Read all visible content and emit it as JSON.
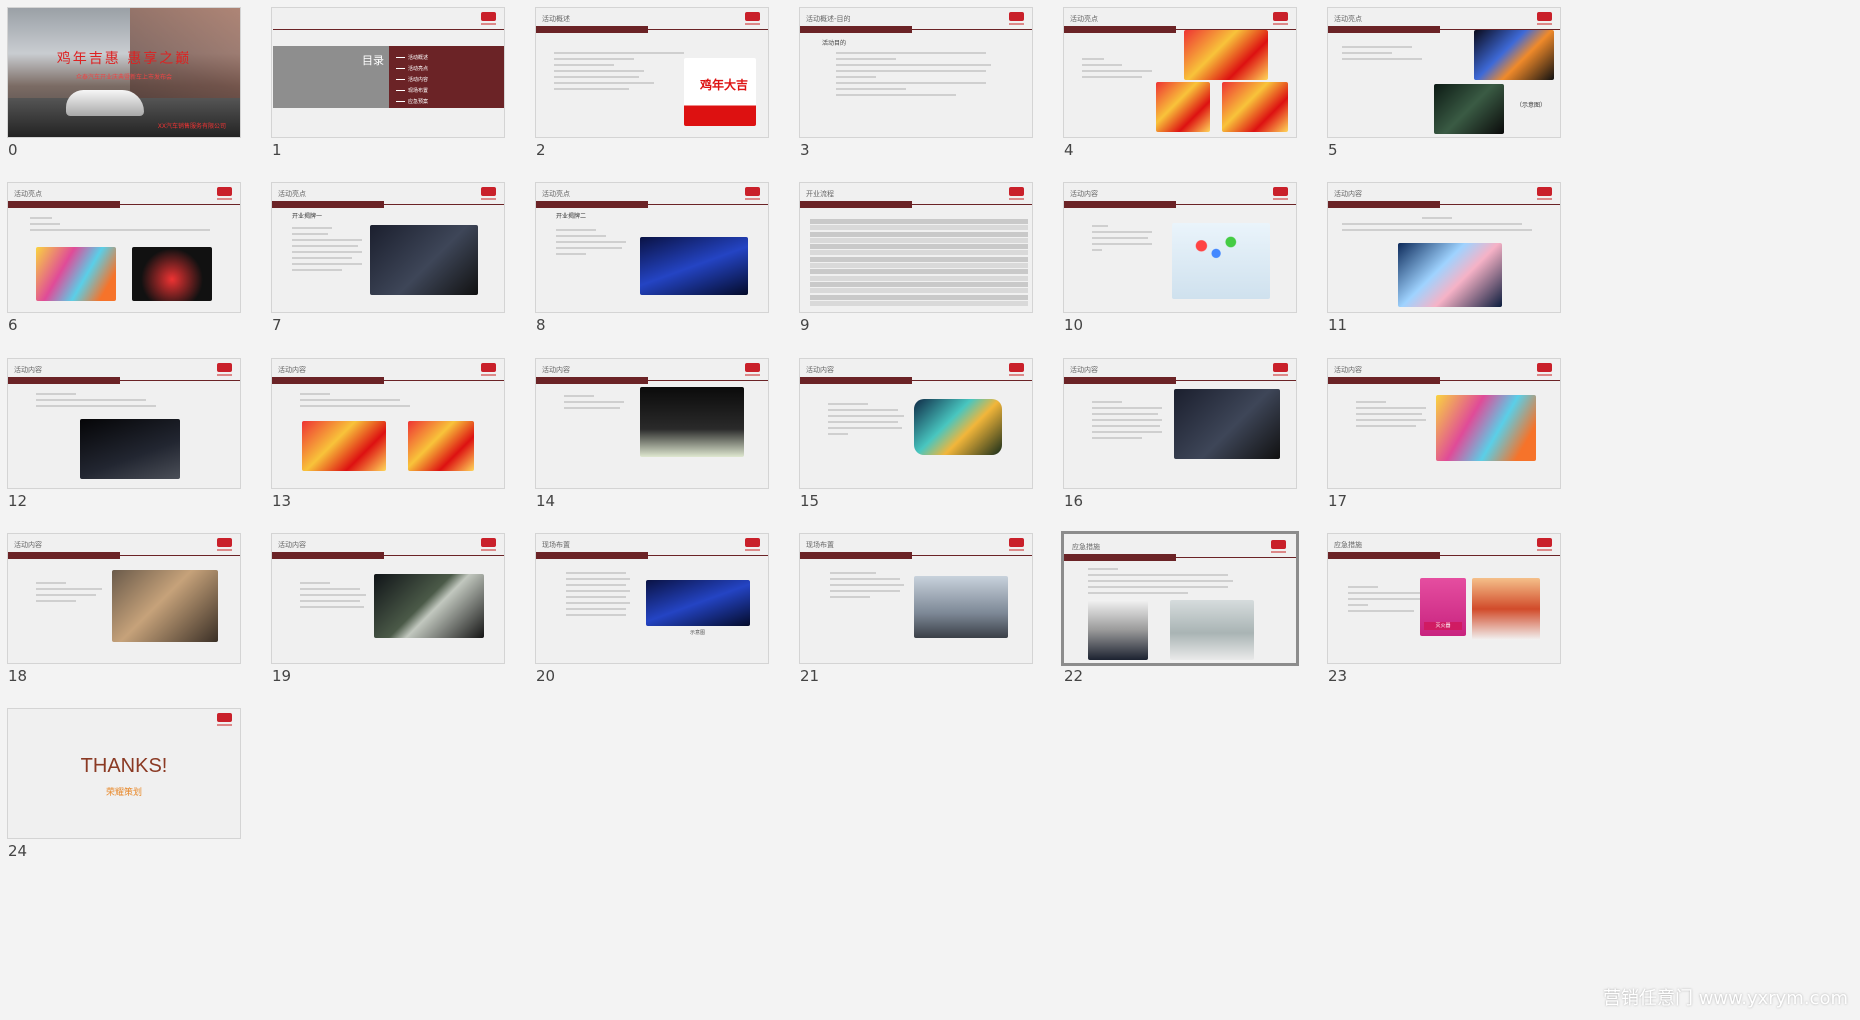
{
  "slides": [
    {
      "index": "0",
      "cover_title": "鸡年吉惠  惠享之巅",
      "cover_sub": "众泰汽车开业庆典暨新车上市发布会",
      "cover_org": "XX汽车销售服务有限公司"
    },
    {
      "index": "1",
      "toc_title": "目录",
      "toc_items": [
        "活动概述",
        "活动亮点",
        "活动内容",
        "现场布置",
        "应急预案"
      ]
    },
    {
      "index": "2",
      "header": "活动概述",
      "poster": "鸡年大吉"
    },
    {
      "index": "3",
      "header": "活动概述-目的",
      "section": "活动目的"
    },
    {
      "index": "4",
      "header": "活动亮点"
    },
    {
      "index": "5",
      "header": "活动亮点",
      "caption": "（示意图）"
    },
    {
      "index": "6",
      "header": "活动亮点"
    },
    {
      "index": "7",
      "header": "活动亮点",
      "section": "开业揭牌一"
    },
    {
      "index": "8",
      "header": "活动亮点",
      "section": "开业揭牌二"
    },
    {
      "index": "9",
      "header": "开业流程"
    },
    {
      "index": "10",
      "header": "活动内容"
    },
    {
      "index": "11",
      "header": "活动内容"
    },
    {
      "index": "12",
      "header": "活动内容"
    },
    {
      "index": "13",
      "header": "活动内容"
    },
    {
      "index": "14",
      "header": "活动内容"
    },
    {
      "index": "15",
      "header": "活动内容"
    },
    {
      "index": "16",
      "header": "活动内容"
    },
    {
      "index": "17",
      "header": "活动内容"
    },
    {
      "index": "18",
      "header": "活动内容"
    },
    {
      "index": "19",
      "header": "活动内容"
    },
    {
      "index": "20",
      "header": "现场布置",
      "caption": "示意图"
    },
    {
      "index": "21",
      "header": "现场布置"
    },
    {
      "index": "22",
      "header": "应急措施"
    },
    {
      "index": "23",
      "header": "应急措施",
      "badge": "灭火器"
    },
    {
      "index": "24",
      "thanks": "THANKS!",
      "thanks_sub": "荣耀策划"
    }
  ],
  "watermark": "营销任意门 www.yxrym.com",
  "colors": {
    "accent": "#6b2326",
    "logo": "#c9202a",
    "background": "#f3f3f3"
  }
}
